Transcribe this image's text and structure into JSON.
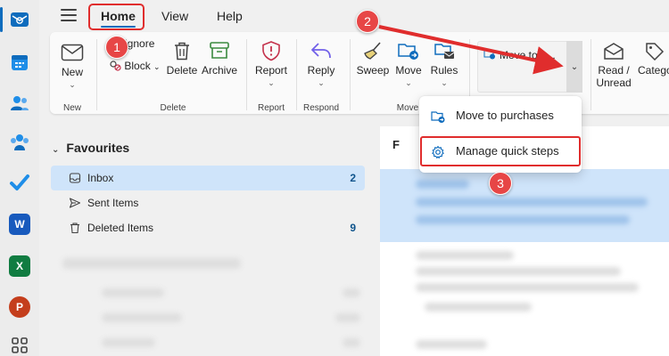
{
  "topbar": {
    "tabs": [
      {
        "label": "Home",
        "active": true
      },
      {
        "label": "View",
        "active": false
      },
      {
        "label": "Help",
        "active": false
      }
    ]
  },
  "ribbon": {
    "new": {
      "label": "New",
      "group": "New"
    },
    "delete_group": {
      "ignore_label": "Ignore",
      "block_label": "Block",
      "delete_label": "Delete",
      "archive_label": "Archive",
      "group": "Delete"
    },
    "report": {
      "label": "Report",
      "group": "Report"
    },
    "reply": {
      "label": "Reply",
      "group": "Respond"
    },
    "move_group": {
      "sweep_label": "Sweep",
      "move_label": "Move",
      "rules_label": "Rules",
      "group": "Move"
    },
    "quick_steps": {
      "label": "Move to p..."
    },
    "read_unread": {
      "label": "Read / Unread"
    },
    "categorize": {
      "label": "Catego"
    }
  },
  "folders": {
    "favourites_label": "Favourites",
    "items": [
      {
        "label": "Inbox",
        "count": "2",
        "selected": true
      },
      {
        "label": "Sent Items",
        "count": "",
        "selected": false
      },
      {
        "label": "Deleted Items",
        "count": "9",
        "selected": false
      }
    ]
  },
  "message_list": {
    "header_initial": "F"
  },
  "quick_steps_menu": {
    "items": [
      {
        "label": "Move to purchases",
        "icon": "folder-move-icon"
      },
      {
        "label": "Manage quick steps",
        "icon": "gear-icon",
        "highlighted": true
      }
    ]
  },
  "annotations": {
    "badges": [
      "1",
      "2",
      "3"
    ]
  },
  "colors": {
    "accent": "#0f6cbd",
    "selection": "#cfe4fa",
    "annotation_red": "#e74646",
    "archive_green": "#3a8a3e",
    "report_red": "#c4314b",
    "reply_purple": "#7160e8"
  }
}
